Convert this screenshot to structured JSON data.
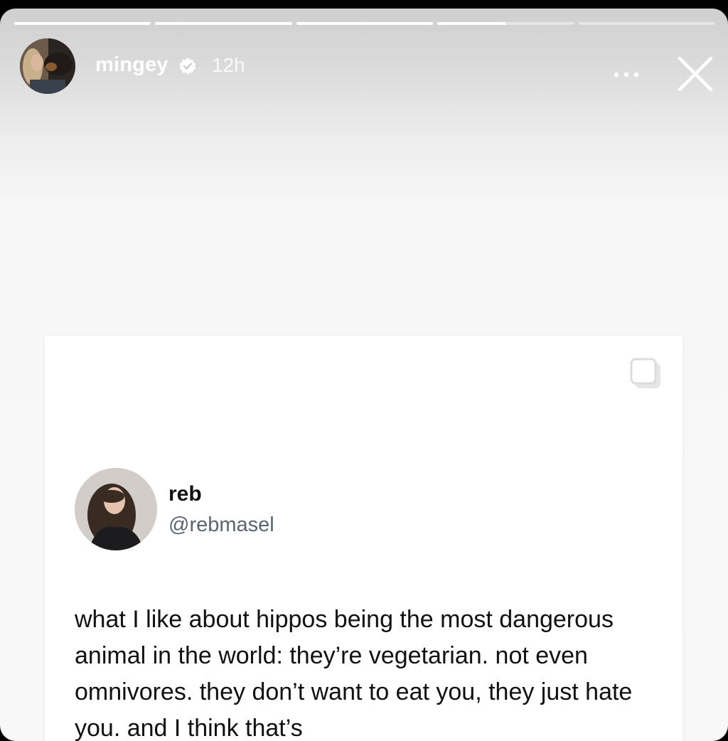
{
  "story": {
    "progress": [
      1,
      1,
      1,
      0.5,
      0
    ],
    "author": {
      "username": "mingey",
      "time": "12h"
    }
  },
  "post": {
    "name": "reb",
    "handle": "@rebmasel",
    "text": "what I like about hippos being the most dangerous animal in the world: they’re vegetarian. not even omnivores. they don’t want to eat you, they just hate you. and I think that’s"
  },
  "icons": {
    "verified": "verified-badge-icon",
    "more": "more-options-icon",
    "close": "close-icon",
    "carousel": "carousel-icon"
  }
}
